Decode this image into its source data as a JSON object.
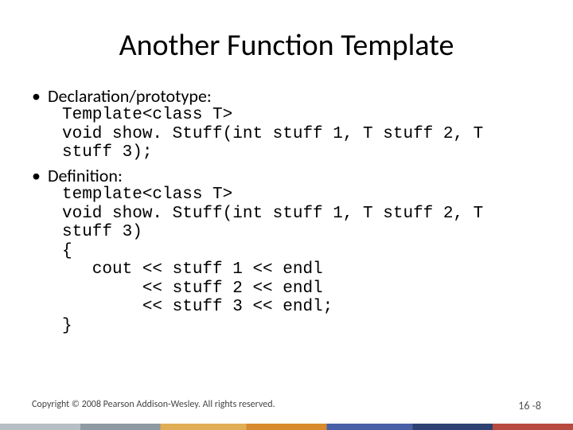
{
  "title": "Another Function Template",
  "bullets": [
    {
      "label": "Declaration/prototype:"
    },
    {
      "label": "Definition:"
    }
  ],
  "code1": "Template<class T>\nvoid show. Stuff(int stuff 1, T stuff 2, T\nstuff 3);",
  "code2": "template<class T>\nvoid show. Stuff(int stuff 1, T stuff 2, T\nstuff 3)\n{\n   cout << stuff 1 << endl\n        << stuff 2 << endl\n        << stuff 3 << endl;\n}",
  "footer": {
    "copyright": "Copyright © 2008 Pearson Addison-Wesley. All rights reserved.",
    "page": "16 -8"
  }
}
